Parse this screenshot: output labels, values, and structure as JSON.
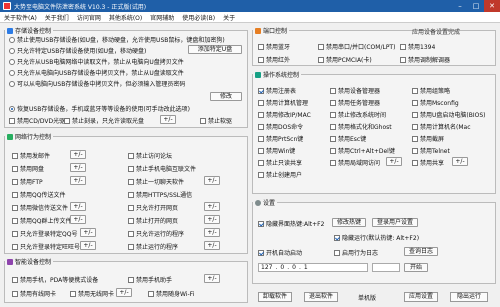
{
  "window": {
    "title": "大势至电脑文件防泄密系统 V10.3 - 正式版(试用)"
  },
  "menu": [
    "关于软件(A)",
    "关于我们",
    "访问官网",
    "其他系统(O)",
    "官网辅助",
    "使用必读(B)",
    "关于"
  ],
  "storage": {
    "title": "存储设备控制",
    "options": [
      {
        "label": "禁止使用USB存储设备(如U盘，移动硬盘，允许使用USB鼠标，键盘和加密狗)",
        "selected": false
      },
      {
        "label": "只允许特定USB存储设备使用(如U盘，移动硬盘)",
        "selected": false
      },
      {
        "label": "只允许从USB电脑网络中读取文件，禁止从电脑向U盘拷贝文件",
        "selected": false
      },
      {
        "label": "只允许从电脑向USB存储设备中拷贝文件，禁止从U盘读取文件",
        "selected": false
      },
      {
        "label": "可以从电脑向USB存储设备中拷贝文件，但必须输入管理员密码",
        "selected": false
      },
      {
        "label": "恢复USB存储设备，手机或蓝牙等等设备的使用(可手动改此选项)",
        "selected": true
      }
    ],
    "add_usb_button": "添加特定U盘",
    "modify_button": "修改",
    "cdrom": {
      "label": "禁用CD/DVD光驱",
      "checked": false
    },
    "only_read": {
      "label": "禁止刻录，只允许读取光盘",
      "checked": false
    },
    "small_btn": "+/-",
    "floppy": {
      "label": "禁止软驱",
      "checked": false
    }
  },
  "network": {
    "title": "网络行为控制",
    "left": [
      {
        "label": "禁用发邮件",
        "checked": false,
        "btn": "+/-"
      },
      {
        "label": "禁用网盘",
        "checked": false,
        "btn": "+/-"
      },
      {
        "label": "禁用FTP",
        "checked": false,
        "btn": "+/-"
      },
      {
        "label": "禁用QQ传送文件",
        "checked": false,
        "btn": ""
      },
      {
        "label": "禁用微信传送文件",
        "checked": false,
        "btn": "+/-"
      },
      {
        "label": "禁用QQ群上传文件",
        "checked": false,
        "btn": "+/-"
      },
      {
        "label": "只允许登录特定QQ号",
        "checked": false,
        "btn": "+/-"
      },
      {
        "label": "只允许登录特定旺旺号",
        "checked": false,
        "btn": "+/-"
      }
    ],
    "right": [
      {
        "label": "禁止访问论坛",
        "checked": false,
        "btn": ""
      },
      {
        "label": "禁止手机电脑互联文件",
        "checked": false,
        "btn": ""
      },
      {
        "label": "禁止一切聊天软件",
        "checked": false,
        "btn": "+/-"
      },
      {
        "label": "禁用HTTPS/SSL通信",
        "checked": false,
        "btn": ""
      },
      {
        "label": "只允许打开网页",
        "checked": false,
        "btn": "+/-"
      },
      {
        "label": "禁止打开的网页",
        "checked": false,
        "btn": "+/-"
      },
      {
        "label": "只允许运行的程序",
        "checked": false,
        "btn": "+/-"
      },
      {
        "label": "禁止运行的程序",
        "checked": false,
        "btn": "+/-"
      }
    ]
  },
  "smart": {
    "title": "智能设备控制",
    "items": [
      {
        "label": "禁用手机，PDA等便携式设备",
        "checked": false
      },
      {
        "label": "禁用手机助手",
        "checked": false
      },
      {
        "label": "禁用有线网卡",
        "checked": false
      },
      {
        "label": "禁用无线网卡",
        "checked": false
      },
      {
        "label": "禁用随身Wi-Fi",
        "checked": false
      }
    ],
    "btn": "+/-"
  },
  "ports": {
    "title": "端口控制",
    "note": "应用设备设置完成",
    "items": [
      {
        "label": "禁用蓝牙",
        "checked": false
      },
      {
        "label": "禁用串口/并口(COM/LPT)",
        "checked": false
      },
      {
        "label": "禁用1394",
        "checked": false
      },
      {
        "label": "禁用红外",
        "checked": false
      },
      {
        "label": "禁用PCMCIA(卡)",
        "checked": false
      },
      {
        "label": "禁用调制解调器",
        "checked": false
      }
    ]
  },
  "os": {
    "title": "操作系统控制",
    "items": [
      {
        "label": "禁用注册表",
        "checked": true
      },
      {
        "label": "禁用设备管理器",
        "checked": false
      },
      {
        "label": "禁用组策略",
        "checked": false
      },
      {
        "label": "禁用计算机管理",
        "checked": false
      },
      {
        "label": "禁用任务管理器",
        "checked": false
      },
      {
        "label": "禁用Msconfig",
        "checked": false
      },
      {
        "label": "禁用修改IP/MAC",
        "checked": false
      },
      {
        "label": "禁止修改系统时间",
        "checked": false
      },
      {
        "label": "禁用U盘启动电脑(BIOS)",
        "checked": false
      },
      {
        "label": "禁用DOS命令",
        "checked": false
      },
      {
        "label": "禁用格式化和Ghost",
        "checked": false
      },
      {
        "label": "禁用计算机名(Mac",
        "checked": false
      },
      {
        "label": "禁用PrtScn键",
        "checked": false
      },
      {
        "label": "禁用Esc键",
        "checked": false
      },
      {
        "label": "禁用截屏",
        "checked": false
      },
      {
        "label": "禁用Win键",
        "checked": false
      },
      {
        "label": "禁用Ctrl+Alt+Del键",
        "checked": false
      },
      {
        "label": "禁用Telnet",
        "checked": false
      },
      {
        "label": "禁止只读共享",
        "checked": false
      },
      {
        "label": "禁用局域网访问",
        "checked": false
      },
      {
        "label": "禁用共享",
        "checked": false
      },
      {
        "label": "禁止创建用户",
        "checked": false
      }
    ],
    "btn": "+/-"
  },
  "settings": {
    "title": "设置",
    "hotkey": {
      "label": "隐藏界面热键:Alt+F2",
      "checked": true
    },
    "modify_hotkey": "修改热键",
    "user_admin": "登录用户设置",
    "startup_hidden": {
      "label": "隐藏运行(默认热键: Alt+F2)",
      "checked": true
    },
    "auto_start": {
      "label": "开机自动启动",
      "checked": true
    },
    "enable_log": {
      "label": "启用行为日志",
      "checked": false
    },
    "view_log": "查询日志",
    "ip": {
      "a": "127",
      "b": "0",
      "c": "0",
      "d": "1",
      "port": "",
      "start_button": "开始"
    }
  },
  "footer": {
    "uninstall": "卸载软件",
    "exit": "退出软件",
    "single": "单机版",
    "apply": "应用设置",
    "hide": "隐出运行"
  },
  "colors": {
    "title_bar": "#1f5fa8",
    "accent": "#1a5fb4",
    "close": "#c0392b"
  }
}
